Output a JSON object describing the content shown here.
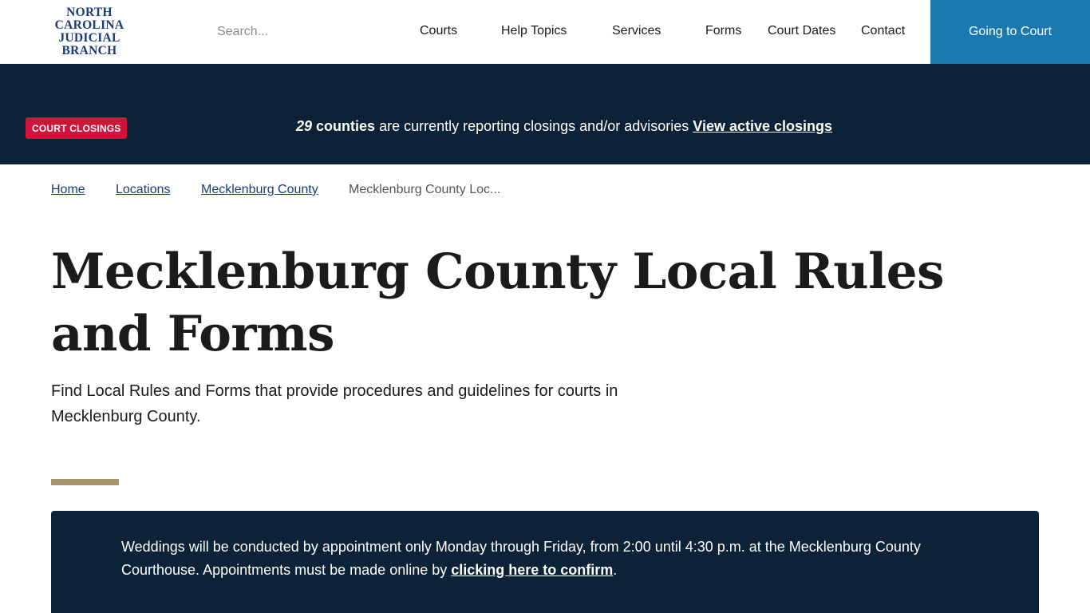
{
  "header": {
    "logo_lines": [
      "NORTH",
      "CAROLINA",
      "JUDICIAL",
      "BRANCH"
    ],
    "search_placeholder": "Search...",
    "nav": [
      "Courts",
      "Help Topics",
      "Services",
      "Forms",
      "Court Dates",
      "Contact"
    ],
    "cta_label": "Going to Court"
  },
  "alert": {
    "badge": "COURT CLOSINGS",
    "count": "29",
    "counties_label": "counties",
    "message": " are currently reporting closings and/or advisories ",
    "link_label": "View active closings"
  },
  "breadcrumb": {
    "items": [
      "Home",
      "Locations",
      "Mecklenburg County"
    ],
    "current": "Mecklenburg County Loc..."
  },
  "main": {
    "title": "Mecklenburg County Local Rules and Forms",
    "lead": "Find Local Rules and Forms that provide procedures and guidelines for courts in Mecklenburg County."
  },
  "notice": {
    "text_before": "Weddings will be conducted by appointment only Monday through Friday, from 2:00 until 4:30 p.m. at the Mecklenburg County Courthouse. Appointments must be made online by ",
    "link_label": "clicking here to confirm",
    "text_after": "."
  },
  "colors": {
    "navy": "#0b2237",
    "cta_blue": "#1a7ab0",
    "alert_red": "#d0133a",
    "accent_gold": "#a8956d",
    "logo_blue": "#1a3a7a"
  }
}
